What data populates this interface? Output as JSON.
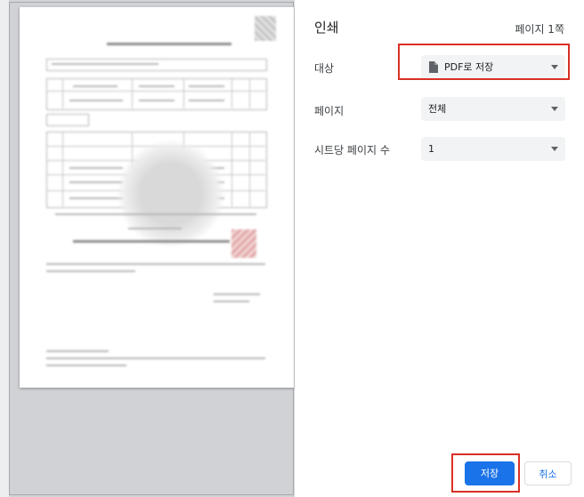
{
  "dialog": {
    "title": "인쇄",
    "page_count": "페이지 1쪽"
  },
  "settings": {
    "destination": {
      "label": "대상",
      "value": "PDF로 저장",
      "icon": "document-icon"
    },
    "pages": {
      "label": "페이지",
      "value": "전체"
    },
    "pages_per_sheet": {
      "label": "시트당 페이지 수",
      "value": "1"
    }
  },
  "buttons": {
    "save": "저장",
    "cancel": "취소"
  },
  "colors": {
    "primary": "#1a73e8",
    "highlight": "#d93025",
    "select_bg": "#f1f3f4"
  }
}
